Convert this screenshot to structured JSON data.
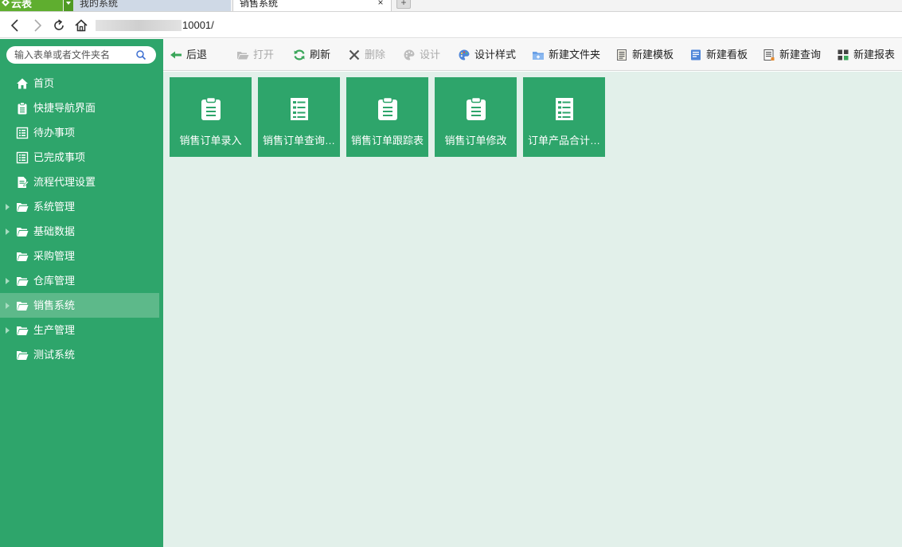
{
  "browser": {
    "brand": "云表",
    "tabs": [
      {
        "label": "我的系统"
      },
      {
        "label": "销售系统"
      }
    ],
    "tab_close": "×",
    "new_tab": "+",
    "url_visible": "10001/"
  },
  "sidebar": {
    "search_placeholder": "输入表单或者文件夹名",
    "items": [
      {
        "label": "首页",
        "icon": "home-icon"
      },
      {
        "label": "快捷导航界面",
        "icon": "clipboard-icon"
      },
      {
        "label": "待办事项",
        "icon": "list-icon"
      },
      {
        "label": "已完成事项",
        "icon": "list-icon"
      },
      {
        "label": "流程代理设置",
        "icon": "document-edit-icon"
      },
      {
        "label": "系统管理",
        "icon": "folder-icon",
        "expandable": true
      },
      {
        "label": "基础数据",
        "icon": "folder-icon",
        "expandable": true
      },
      {
        "label": "采购管理",
        "icon": "folder-icon"
      },
      {
        "label": "仓库管理",
        "icon": "folder-icon",
        "expandable": true
      },
      {
        "label": "销售系统",
        "icon": "folder-icon",
        "expandable": true,
        "active": true
      },
      {
        "label": "生产管理",
        "icon": "folder-icon",
        "expandable": true
      },
      {
        "label": "测试系统",
        "icon": "folder-icon"
      }
    ]
  },
  "toolbar": {
    "back": "后退",
    "open": "打开",
    "refresh": "刷新",
    "delete": "删除",
    "design": "设计",
    "design_style": "设计样式",
    "new_folder": "新建文件夹",
    "new_template": "新建模板",
    "new_board": "新建看板",
    "new_query": "新建查询",
    "new_report": "新建报表"
  },
  "tiles": [
    {
      "label": "销售订单录入",
      "icon": "clipboard-icon"
    },
    {
      "label": "销售订单查询…",
      "icon": "list-icon"
    },
    {
      "label": "销售订单跟踪表",
      "icon": "clipboard-icon"
    },
    {
      "label": "销售订单修改",
      "icon": "clipboard-icon"
    },
    {
      "label": "订单产品合计…",
      "icon": "list-icon"
    }
  ],
  "colors": {
    "sidebar_bg": "#2ea56b",
    "active_item_bg": "#5db98a",
    "main_bg": "#e2f0ea",
    "tile_bg": "#2ea56b",
    "brand_bg": "#5fae2f"
  }
}
